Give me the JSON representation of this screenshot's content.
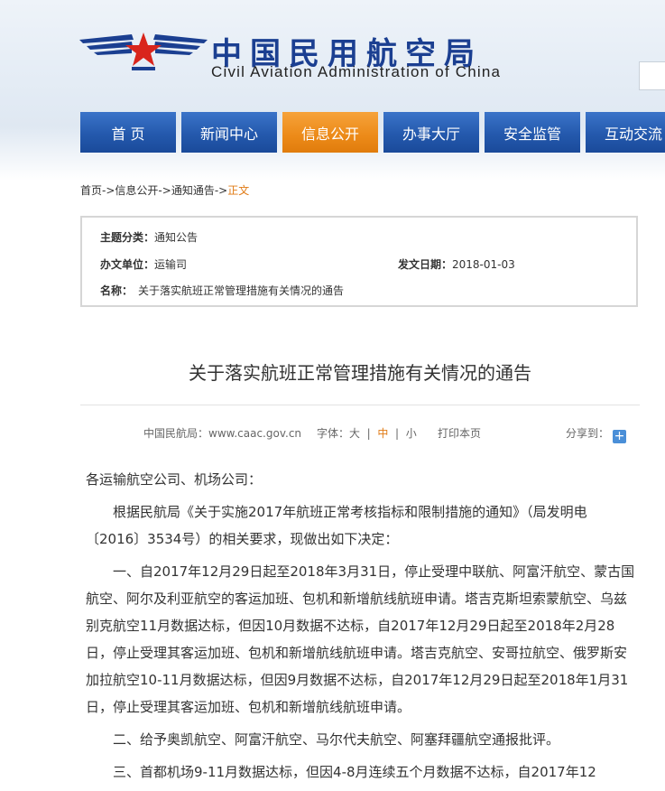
{
  "header": {
    "title_cn": "中国民用航空局",
    "title_en": "Civil Aviation Administration of China"
  },
  "nav": [
    {
      "label": "首 页"
    },
    {
      "label": "新闻中心"
    },
    {
      "label": "信息公开",
      "active": true
    },
    {
      "label": "办事大厅"
    },
    {
      "label": "安全监管"
    },
    {
      "label": "互动交流"
    }
  ],
  "breadcrumb": {
    "home": "首页",
    "sep": "->",
    "level1": "信息公开",
    "level2": "通知通告",
    "current": "正文"
  },
  "info": {
    "category_label": "主题分类：",
    "category": "通知公告",
    "unit_label": "办文单位：",
    "unit": "运输司",
    "date_label": "发文日期：",
    "date": "2018-01-03",
    "name_label": "名称：",
    "name": "关于落实航班正常管理措施有关情况的通告"
  },
  "article": {
    "title": "关于落实航班正常管理措施有关情况的通告",
    "source": "中国民航局：www.caac.gov.cn",
    "font_label": "字体：",
    "font_large": "大",
    "font_medium": "中",
    "font_small": "小",
    "font_sep": "|",
    "print": "打印本页",
    "share": "分享到：",
    "paragraphs": [
      "各运输航空公司、机场公司：",
      "根据民航局《关于实施2017年航班正常考核指标和限制措施的通知》（局发明电〔2016〕3534号）的相关要求，现做出如下决定：",
      "一、自2017年12月29日起至2018年3月31日，停止受理中联航、阿富汗航空、蒙古国航空、阿尔及利亚航空的客运加班、包机和新增航线航班申请。塔吉克斯坦索蒙航空、乌兹别克航空11月数据达标，但因10月数据不达标，自2017年12月29日起至2018年2月28日，停止受理其客运加班、包机和新增航线航班申请。塔吉克航空、安哥拉航空、俄罗斯安加拉航空10-11月数据达标，但因9月数据不达标，自2017年12月29日起至2018年1月31日，停止受理其客运加班、包机和新增航线航班申请。",
      "二、给予奥凯航空、阿富汗航空、马尔代夫航空、阿塞拜疆航空通报批评。",
      "三、首都机场9-11月数据达标，但因4-8月连续五个月数据不达标，自2017年12"
    ]
  }
}
